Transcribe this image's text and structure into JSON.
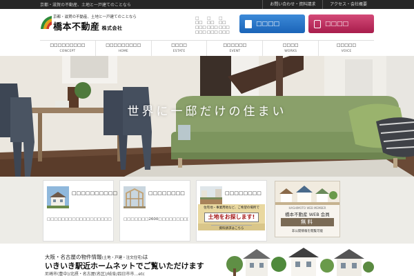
{
  "topbar": {
    "left_text": "京都・滋賀の不動産、土地と一戸建てのことなら",
    "links": [
      "お問い合わせ・資料請求",
      "アクセス・会社概要"
    ]
  },
  "header": {
    "tagline": "京都・滋賀の不動産、土地と一戸建てのことなら",
    "company_name": "橋本不動産",
    "company_suffix": "株式会社",
    "contact_columns": [
      [
        "□",
        "□□",
        "□□□",
        "□□□"
      ],
      [
        "□",
        "□□",
        "□□□",
        "□□□"
      ],
      [
        "□",
        "□□",
        "□□□",
        "□□□"
      ]
    ],
    "buttons": {
      "primary_label": "□□□□",
      "secondary_label": "□□□□"
    },
    "colors": {
      "primary": "#1f6cc0",
      "secondary": "#b82757"
    }
  },
  "nav": [
    {
      "jp": "□□□□□□□□□",
      "en": "CONCEPT"
    },
    {
      "jp": "□□□□□□□□□",
      "en": "HOME"
    },
    {
      "jp": "□□□□",
      "en": "ESTATE"
    },
    {
      "jp": "□□□□□□",
      "en": "EVENT"
    },
    {
      "jp": "□□□□",
      "en": "WORKS"
    },
    {
      "jp": "□□□□□",
      "en": "VOICE"
    }
  ],
  "hero": {
    "title": "世界に一邸だけの住まい"
  },
  "cards": [
    {
      "title": "□□□□□□□□□□",
      "text": "□□□□□□□□□□□□□□□□□□□□□□□□□□□□□□□□□□"
    },
    {
      "title": "□□□□□□□□",
      "text": "□□□□□□□2600□□□□□□□□□□□□□□□□□□□□"
    },
    {
      "title": "□□□□□□□□",
      "ad_sub": "住宅地・事業用地など、ご希望の場所で",
      "ad_main": "土地をお探します!",
      "ad_more": "資料請求はこちら"
    }
  ],
  "member": {
    "subtitle": "HASHIMOTO WEB MEMBER",
    "title": "橋本不動産 WEB 会員",
    "free": "無料",
    "footer": "非公開情報を閲覧可能"
  },
  "bottom": {
    "line1_main": "大阪・名古屋の物件情報",
    "line1_small": "(土地・戸建・注文住宅)",
    "line1_tail": "は",
    "line2": "いきいき駅近ホームネットでご覧いただけます",
    "line3": "尼崎市(豊中)/北摂・名古屋(名区)/岐阜/四日市市…etc"
  }
}
